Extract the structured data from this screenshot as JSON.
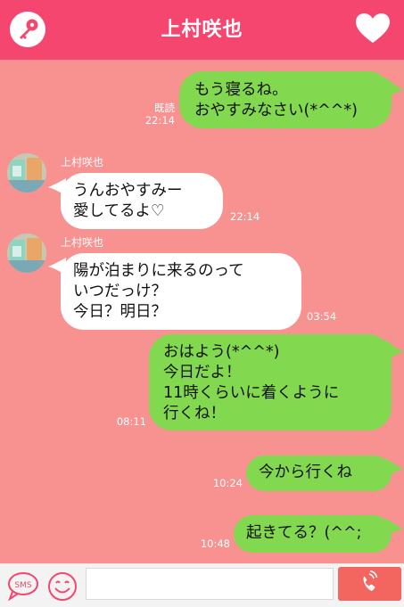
{
  "header": {
    "title": "上村咲也"
  },
  "messages": [
    {
      "side": "me",
      "text": "もう寝るね。\nおやすみなさい(*^^*)",
      "read": "既読",
      "time": "22:14"
    },
    {
      "side": "them",
      "sender": "上村咲也",
      "text": "うんおやすみー\n愛してるよ♡",
      "time": "22:14"
    },
    {
      "side": "them",
      "sender": "上村咲也",
      "text": "陽が泊まりに来るのって\nいつだっけ？\n今日？明日？",
      "time": "03:54"
    },
    {
      "side": "me",
      "text": "おはよう(*^^*)\n今日だよ！\n11時くらいに着くように\n行くね！",
      "time": "08:11"
    },
    {
      "side": "me",
      "text": "今から行くね",
      "time": "10:24"
    },
    {
      "side": "me",
      "text": "起きてる？(^^;",
      "time": "10:48"
    }
  ],
  "footer": {
    "sms_label": "SMS",
    "input_value": "",
    "input_placeholder": ""
  },
  "colors": {
    "header": "#f5466f",
    "background": "#f79291",
    "my_bubble": "#82d84e",
    "their_bubble": "#ffffff",
    "send_button": "#f3655f"
  },
  "icons": {
    "header_left": "key-icon",
    "header_right": "heart-icon",
    "footer_sms": "sms-icon",
    "footer_emoji": "smiley-icon",
    "footer_send": "phone-icon"
  }
}
